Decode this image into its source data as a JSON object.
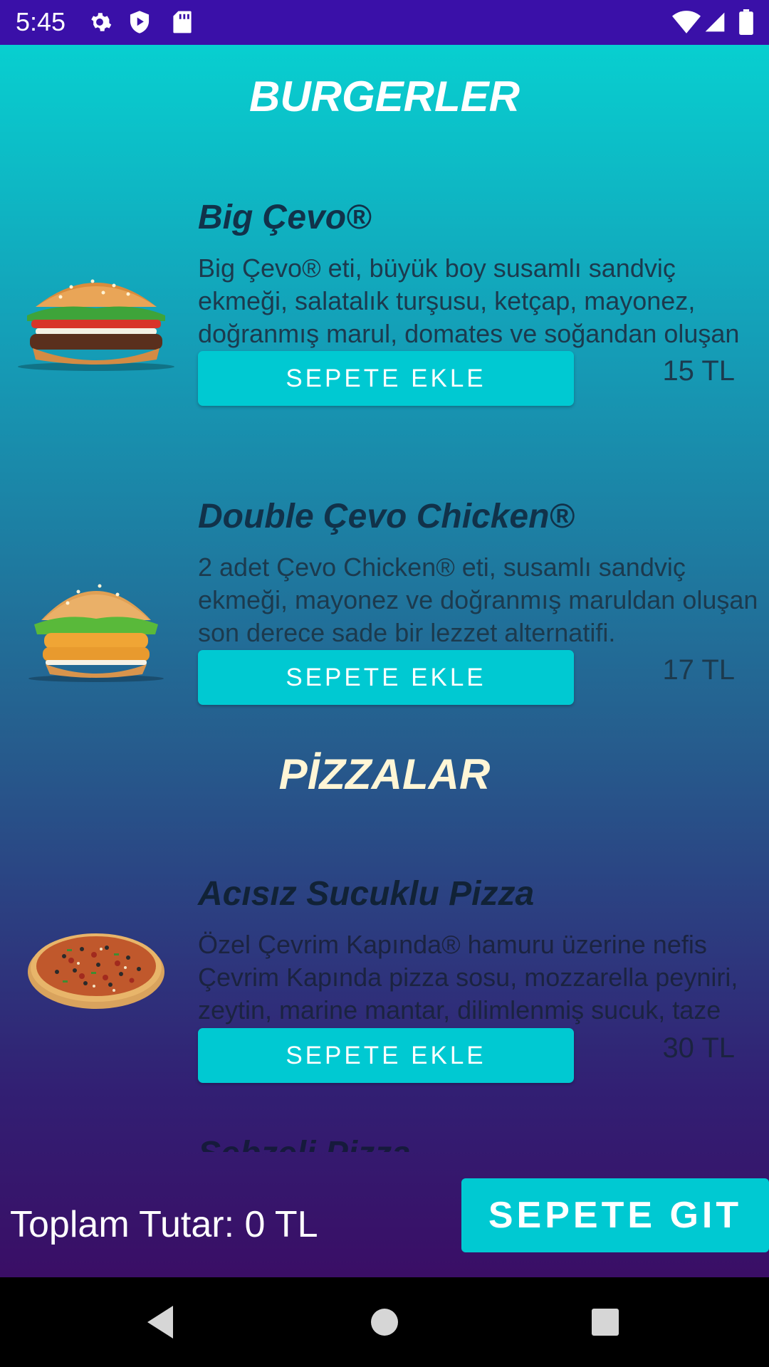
{
  "status_bar": {
    "time": "5:45",
    "left_icons": [
      "gear-icon",
      "play-protect-icon",
      "sd-card-icon"
    ],
    "right_icons": [
      "wifi-icon",
      "signal-icon",
      "battery-icon"
    ],
    "background": "#3a10a8"
  },
  "sections": {
    "burgers_title": "BURGERLER",
    "pizzas_title": "PİZZALAR"
  },
  "items": [
    {
      "name": "Big Çevo®",
      "description": "Big Çevo® eti, büyük boy susamlı sandviç ekmeği, salatalık turşusu, ketçap, mayonez, doğranmış marul, domates ve soğandan oluşan bir Çevrim Kapında® klasiği.",
      "button": "SEPETE EKLE",
      "price": "15 TL",
      "image": "burger-image"
    },
    {
      "name": "Double Çevo Chicken®",
      "description": "2 adet Çevo Chicken® eti, susamlı sandviç ekmeği, mayonez ve doğranmış maruldan oluşan son derece sade bir lezzet alternatifi.",
      "button": "SEPETE EKLE",
      "price": "17 TL",
      "image": "chicken-burger-image"
    },
    {
      "name": "Acısız Sucuklu Pizza",
      "description": "Özel Çevrim Kapında® hamuru üzerine nefis Çevrim Kapında pizza sosu, mozzarella peyniri, zeytin, marine mantar, dilimlenmiş sucuk, taze dilimlenmiş kırmızı ve yeşil biber!",
      "button": "SEPETE EKLE",
      "price": "30 TL",
      "image": "pizza-image"
    },
    {
      "name": "Sebzeli Pizza"
    }
  ],
  "footer": {
    "total": "Toplam Tutar: 0 TL",
    "go_button": "SEPETE GIT"
  },
  "nav": {
    "icons": [
      "back-icon",
      "home-icon",
      "recents-icon"
    ]
  },
  "colors": {
    "accent": "#00c9d2",
    "gradient_top": "#08cfd0",
    "gradient_bottom": "#3a0e66",
    "item_name_color": "#11324a",
    "item_text_color": "#1c3a4e"
  }
}
